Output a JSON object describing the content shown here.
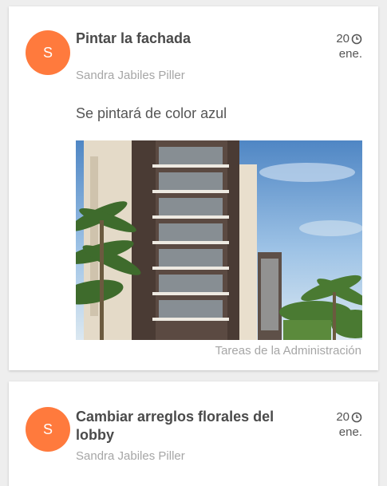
{
  "colors": {
    "avatar_bg": "#ff7a3d"
  },
  "icons": {
    "date_icon": "clock-icon"
  },
  "posts": [
    {
      "avatar_letter": "S",
      "title": "Pintar la fachada",
      "author": "Sandra Jabiles Piller",
      "date_day": "20",
      "date_month": "ene.",
      "description": "Se pintará de color azul",
      "has_image": true,
      "category": "Tareas de la Administración"
    },
    {
      "avatar_letter": "S",
      "title": "Cambiar arreglos florales del lobby",
      "author": "Sandra Jabiles Piller",
      "date_day": "20",
      "date_month": "ene."
    }
  ]
}
